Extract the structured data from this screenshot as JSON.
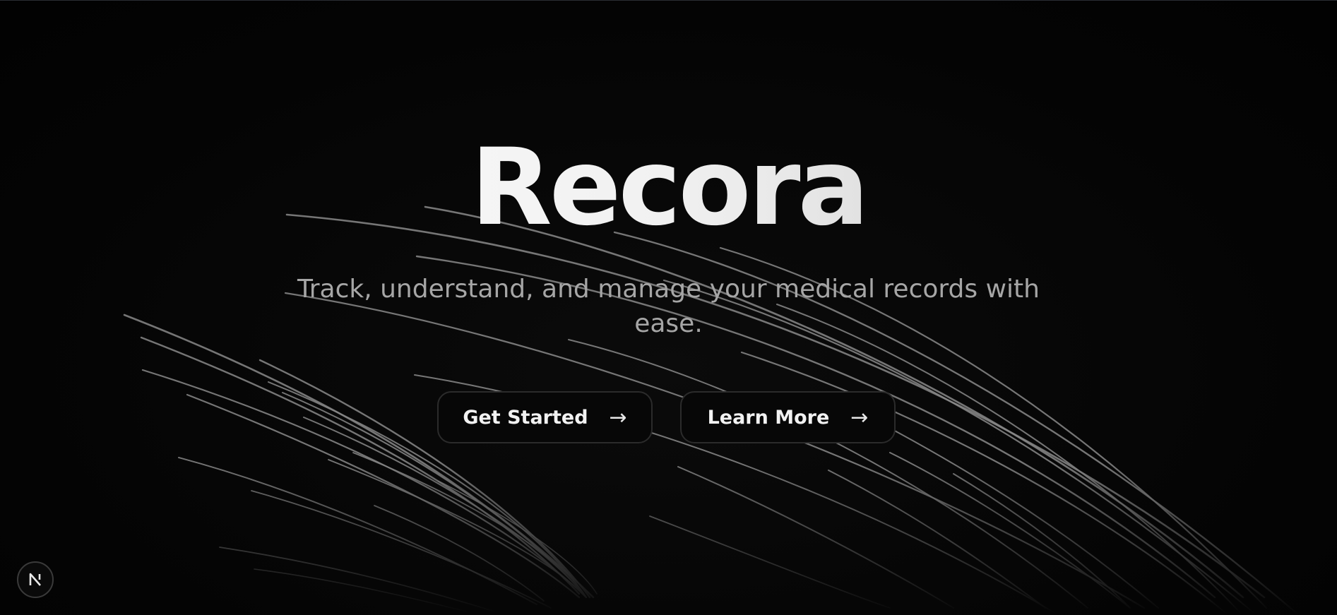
{
  "hero": {
    "title": "Recora",
    "subtitle": "Track, understand, and manage your medical records with ease."
  },
  "actions": {
    "get_started_label": "Get Started",
    "learn_more_label": "Learn More",
    "arrow_glyph": "→"
  },
  "dev_badge": {
    "icon": "nextjs-logo-icon",
    "letter": "N"
  },
  "colors": {
    "background": "#050505",
    "line": "#8a8a8a",
    "title": "#f2f2f2",
    "subtitle": "#a6a6a6",
    "button_border": "#2b2b2b"
  }
}
